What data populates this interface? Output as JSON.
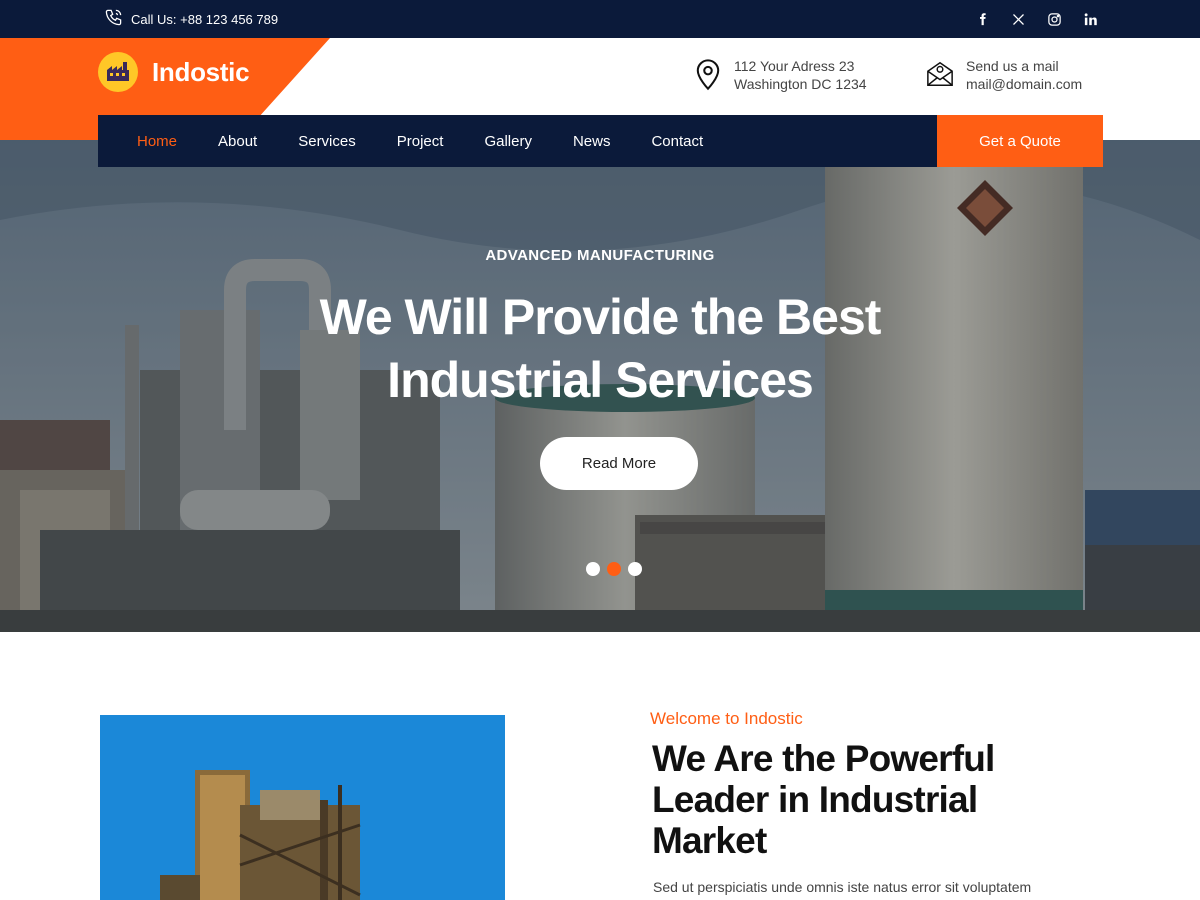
{
  "topbar": {
    "call_text": "Call Us: +88 123 456 789",
    "socials": [
      "facebook-icon",
      "x-icon",
      "instagram-icon",
      "linkedin-icon"
    ]
  },
  "brand": {
    "name": "Indostic",
    "accent_color": "#ff5e14",
    "navy_color": "#0b1a3a"
  },
  "contact": {
    "address_line1": "112 Your Adress 23",
    "address_line2": "Washington DC 1234",
    "mail_line1": "Send us a mail",
    "mail_line2": "mail@domain.com"
  },
  "nav": {
    "items": [
      {
        "label": "Home",
        "active": true
      },
      {
        "label": "About"
      },
      {
        "label": "Services"
      },
      {
        "label": "Project"
      },
      {
        "label": "Gallery"
      },
      {
        "label": "News"
      },
      {
        "label": "Contact"
      }
    ],
    "cta": "Get a Quote"
  },
  "hero": {
    "eyebrow": "ADVANCED MANUFACTURING",
    "title_line1": "We Will Provide the Best",
    "title_line2": "Industrial Services",
    "button": "Read More",
    "slides": 3,
    "active_slide": 2
  },
  "about": {
    "kicker": "Welcome to Indostic",
    "title_line1": "We Are the Powerful",
    "title_line2": "Leader in Industrial",
    "title_line3": "Market",
    "text": "Sed ut perspiciatis unde omnis iste natus error sit voluptatem"
  }
}
